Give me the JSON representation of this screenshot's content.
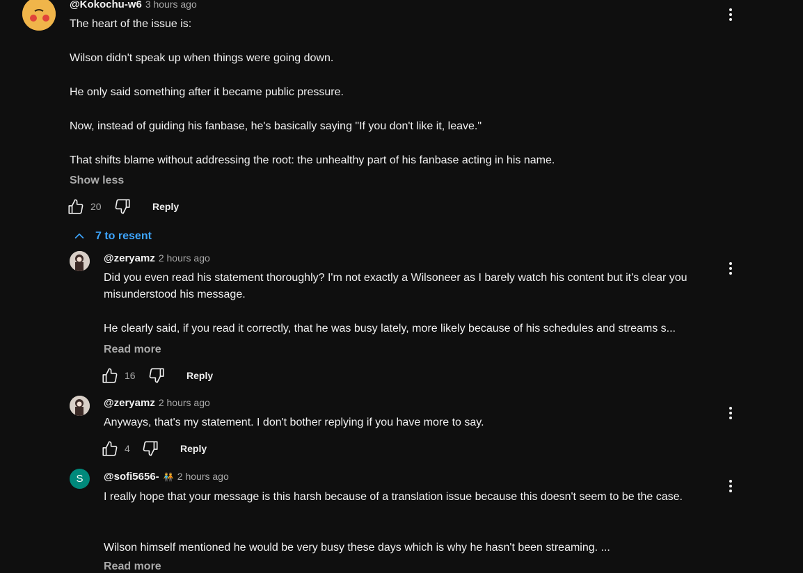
{
  "comment": {
    "author": "@Kokochu-w6",
    "time": "3 hours ago",
    "paragraphs": [
      "The heart of the issue is:",
      "Wilson didn't speak up when things were going down.",
      "He only said something after it became public pressure.",
      "Now, instead of guiding his fanbase, he's basically saying \"If you don't like it, leave.\"",
      "That shifts blame without addressing the root: the unhealthy part of his fanbase acting in his name."
    ],
    "toggle": "Show less",
    "likes": "20",
    "reply_label": "Reply"
  },
  "replies_toggle": "7 to resent",
  "replies": [
    {
      "author": "@zeryamz",
      "time": "2 hours ago",
      "p1": "Did you even read his statement thoroughly? I'm not exactly a Wilsoneer as I barely watch his content but it's clear you misunderstood his message.",
      "p2": "He clearly said, if you read it correctly, that he was busy lately, more likely because of his schedules and streams s...",
      "toggle": "Read more",
      "likes": "16",
      "reply_label": "Reply"
    },
    {
      "author": "@zeryamz",
      "time": "2 hours ago",
      "p1": "Anyways, that's my statement. I don't bother replying if you have more to say.",
      "likes": "4",
      "reply_label": "Reply"
    },
    {
      "author": "@sofi5656-",
      "badge": "🧑‍🤝‍🧑",
      "time": "2 hours ago",
      "avatar_letter": "S",
      "p1": "I really hope that your message is this harsh because of a translation issue because this doesn't seem to be the case.",
      "p2": "Wilson himself mentioned he would be very busy these days which is why he hasn't been streaming. ...",
      "toggle": "Read more"
    }
  ],
  "colors": {
    "background": "#0f0f0f",
    "link_blue": "#3ea6ff",
    "avatar_s": "#00897b"
  }
}
